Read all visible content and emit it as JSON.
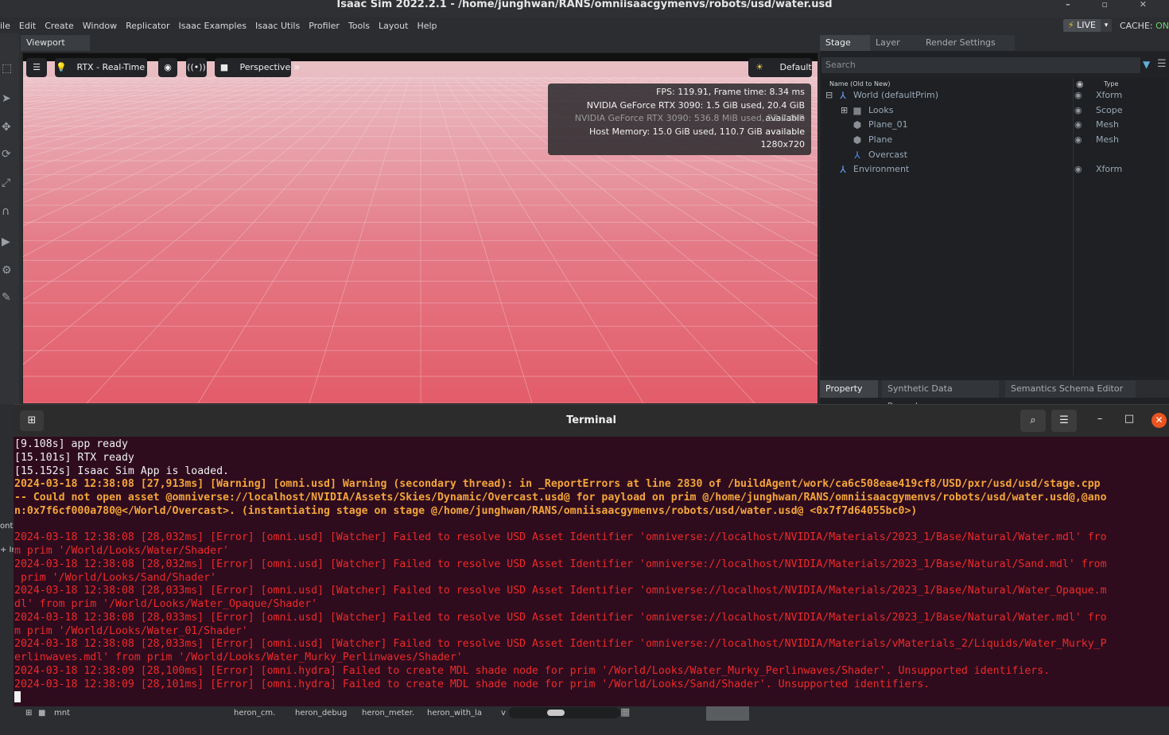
{
  "window": {
    "title": "Isaac Sim 2022.2.1 - /home/junghwan/RANS/omniisaacgymenvs/robots/usd/water.usd"
  },
  "menu": [
    "ile",
    "Edit",
    "Create",
    "Window",
    "Replicator",
    "Isaac Examples",
    "Isaac Utils",
    "Profiler",
    "Tools",
    "Layout",
    "Help"
  ],
  "live": {
    "label": "LIVE",
    "cache_label": "CACHE:",
    "cache_status": "ON"
  },
  "viewport": {
    "tab": "Viewport",
    "renderer": "RTX - Real-Time",
    "camera": "Perspective",
    "lighting": "Default",
    "stats": {
      "fps": "FPS: 119.91, Frame time: 8.34 ms",
      "gpu0": "NVIDIA GeForce RTX 3090: 1.5 GiB used, 20.4 GiB available",
      "gpu1": "NVIDIA GeForce RTX 3090: 536.8 MiB used, 22.7 GiB available",
      "host": "Host Memory: 15.0 GiB used, 110.7 GiB available",
      "resolution": "1280x720"
    }
  },
  "stage": {
    "tabs": [
      "Stage",
      "Layer",
      "Render Settings"
    ],
    "search_placeholder": "Search",
    "col_name": "Name (Old to New)",
    "col_type": "Type",
    "rows": [
      {
        "name": "World (defaultPrim)",
        "type": "Xform"
      },
      {
        "name": "Looks",
        "type": "Scope"
      },
      {
        "name": "Plane_01",
        "type": "Mesh"
      },
      {
        "name": "Plane",
        "type": "Mesh"
      },
      {
        "name": "Overcast",
        "type": ""
      },
      {
        "name": "Environment",
        "type": "Xform"
      }
    ]
  },
  "property_tabs": [
    "Property",
    "Synthetic Data Recorder",
    "Semantics Schema Editor"
  ],
  "terminal": {
    "title": "Terminal",
    "lines": [
      {
        "t": "[9.108s] app ready",
        "c": "white"
      },
      {
        "t": "[15.101s] RTX ready",
        "c": "white"
      },
      {
        "t": "[15.152s] Isaac Sim App is loaded.",
        "c": "white"
      },
      {
        "t": "2024-03-18 12:38:08 [27,913ms] [Warning] [omni.usd] Warning (secondary thread): in _ReportErrors at line 2830 of /buildAgent/work/ca6c508eae419cf8/USD/pxr/usd/usd/stage.cpp",
        "c": "warn"
      },
      {
        "t": "-- Could not open asset @omniverse://localhost/NVIDIA/Assets/Skies/Dynamic/Overcast.usd@ for payload on prim @/home/junghwan/RANS/omniisaacgymenvs/robots/usd/water.usd@,@ano",
        "c": "warn"
      },
      {
        "t": "n:0x7f6cf000a780@</World/Overcast>. (instantiating stage on stage @/home/junghwan/RANS/omniisaacgymenvs/robots/usd/water.usd@ <0x7f7d64055bc0>)",
        "c": "warn"
      },
      {
        "t": "",
        "c": "white"
      },
      {
        "t": "2024-03-18 12:38:08 [28,032ms] [Error] [omni.usd] [Watcher] Failed to resolve USD Asset Identifier 'omniverse://localhost/NVIDIA/Materials/2023_1/Base/Natural/Water.mdl' fro",
        "c": "err"
      },
      {
        "t": "m prim '/World/Looks/Water/Shader'",
        "c": "err"
      },
      {
        "t": "2024-03-18 12:38:08 [28,032ms] [Error] [omni.usd] [Watcher] Failed to resolve USD Asset Identifier 'omniverse://localhost/NVIDIA/Materials/2023_1/Base/Natural/Sand.mdl' from",
        "c": "err"
      },
      {
        "t": " prim '/World/Looks/Sand/Shader'",
        "c": "err"
      },
      {
        "t": "2024-03-18 12:38:08 [28,033ms] [Error] [omni.usd] [Watcher] Failed to resolve USD Asset Identifier 'omniverse://localhost/NVIDIA/Materials/2023_1/Base/Natural/Water_Opaque.m",
        "c": "err"
      },
      {
        "t": "dl' from prim '/World/Looks/Water_Opaque/Shader'",
        "c": "err"
      },
      {
        "t": "2024-03-18 12:38:08 [28,033ms] [Error] [omni.usd] [Watcher] Failed to resolve USD Asset Identifier 'omniverse://localhost/NVIDIA/Materials/2023_1/Base/Natural/Water.mdl' fro",
        "c": "err"
      },
      {
        "t": "m prim '/World/Looks/Water_01/Shader'",
        "c": "err"
      },
      {
        "t": "2024-03-18 12:38:08 [28,033ms] [Error] [omni.usd] [Watcher] Failed to resolve USD Asset Identifier 'omniverse://localhost/NVIDIA/Materials/vMaterials_2/Liquids/Water_Murky_P",
        "c": "err"
      },
      {
        "t": "erlinwaves.mdl' from prim '/World/Looks/Water_Murky_Perlinwaves/Shader'",
        "c": "err"
      },
      {
        "t": "2024-03-18 12:38:09 [28,100ms] [Error] [omni.hydra] Failed to create MDL shade node for prim '/World/Looks/Water_Murky_Perlinwaves/Shader'. Unsupported identifiers.",
        "c": "err"
      },
      {
        "t": "2024-03-18 12:38:09 [28,101ms] [Error] [omni.hydra] Failed to create MDL shade node for prim '/World/Looks/Sand/Shader'. Unsupported identifiers.",
        "c": "err"
      }
    ]
  },
  "content_browser": {
    "folder": "mnt",
    "items": [
      "heron_cm.",
      "heron_debug",
      "heron_meter.",
      "heron_with_la",
      "v"
    ]
  },
  "left_peek": [
    "ont",
    "+ In"
  ]
}
